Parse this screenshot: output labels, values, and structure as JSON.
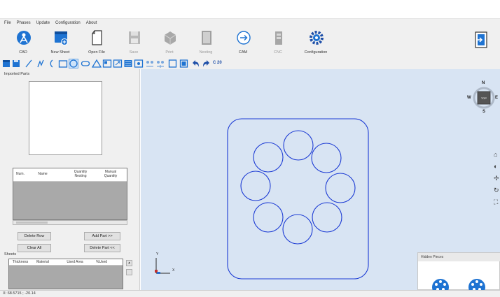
{
  "menu": [
    "File",
    "Phases",
    "Update",
    "Configuration",
    "About"
  ],
  "ribbon": [
    {
      "label": "CAD",
      "icon": "cad-icon",
      "enabled": true
    },
    {
      "label": "New Sheet",
      "icon": "new-sheet-icon",
      "enabled": true
    },
    {
      "label": "Open File",
      "icon": "open-file-icon",
      "enabled": true
    },
    {
      "label": "Save",
      "icon": "save-icon",
      "enabled": false
    },
    {
      "label": "Print",
      "icon": "print-icon",
      "enabled": false
    },
    {
      "label": "Nesting",
      "icon": "nesting-icon",
      "enabled": false
    },
    {
      "label": "CAM",
      "icon": "cam-icon",
      "enabled": true
    },
    {
      "label": "CNC",
      "icon": "cnc-icon",
      "enabled": false
    },
    {
      "label": "Configuration",
      "icon": "configuration-icon",
      "enabled": true
    }
  ],
  "drawbar": {
    "tools": [
      "new-icon",
      "save-icon",
      "line-icon",
      "polyline-icon",
      "arc-icon",
      "rectangle-icon",
      "circle-icon",
      "slot-icon",
      "triangle-icon",
      "zoom-window-icon",
      "zoom-fit-icon",
      "hatch-icon",
      "grid-snap-icon",
      "mirror-icon",
      "array-icon",
      "box-icon",
      "frame-icon",
      "undo-icon",
      "redo-icon"
    ],
    "code": "C 20"
  },
  "left": {
    "imported_parts_label": "Imported Parts",
    "parts_table": {
      "headers": [
        "Num.",
        "Name",
        "Quantity Nesting",
        "Manual Quantity"
      ],
      "rows": []
    },
    "buttons": {
      "delete_row": "Delete Row",
      "add_part": "Add Part >>",
      "clear_all": "Clear All",
      "delete_part": "Delete Part <<"
    },
    "sheets_label": "Sheets",
    "sheets_table": {
      "headers": [
        "Thickness",
        "Material",
        "Used Area",
        "%Used"
      ]
    }
  },
  "viewcube": {
    "north": "N",
    "south": "S",
    "east": "E",
    "west": "W",
    "face": "TOP"
  },
  "axes": {
    "x": "X",
    "y": "Y"
  },
  "hidden_pieces_label": "Hidden Pieces",
  "status": "X: 68.5715 ; -20.14",
  "colors": {
    "viewport_bg": "#d8e4f3",
    "geometry": "#1c3bd4",
    "accent": "#1e73d2"
  }
}
